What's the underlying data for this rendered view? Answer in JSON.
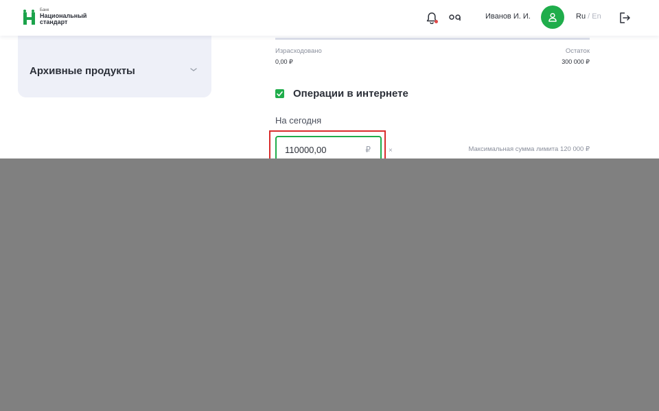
{
  "header": {
    "logo": {
      "small": "Банк",
      "line1": "Национальный",
      "line2": "стандарт"
    },
    "user_name": "Иванов И. И.",
    "lang_ru": "Ru",
    "lang_sep": " / ",
    "lang_en": "En"
  },
  "sidebar": {
    "archive_title": "Архивные продукты"
  },
  "limits": {
    "spent_label": "Израсходовано",
    "spent_value": "0,00 ₽",
    "rest_label": "Остаток",
    "rest_value": "300 000 ₽"
  },
  "internet_ops": {
    "title": "Операции в интернете",
    "checked": true,
    "today_label": "На сегодня",
    "amount_value": "110000,00",
    "currency": "₽",
    "clear": "×",
    "max_limit": "Максимальная сумма лимита 120 000 ₽"
  },
  "colors": {
    "accent": "#1fad4b",
    "highlight": "#d92b2b",
    "overlay": "#808080"
  }
}
